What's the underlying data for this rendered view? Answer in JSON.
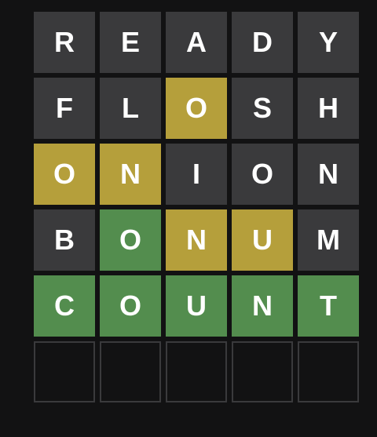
{
  "colors": {
    "background": "#121213",
    "absent": "#3a3a3c",
    "present": "#b59f3b",
    "correct": "#538d4e",
    "empty_border": "#3a3a3c",
    "letter": "#ffffff"
  },
  "board": {
    "rows": [
      {
        "letters": [
          "R",
          "E",
          "A",
          "D",
          "Y"
        ],
        "states": [
          "absent",
          "absent",
          "absent",
          "absent",
          "absent"
        ]
      },
      {
        "letters": [
          "F",
          "L",
          "O",
          "S",
          "H"
        ],
        "states": [
          "absent",
          "absent",
          "present",
          "absent",
          "absent"
        ]
      },
      {
        "letters": [
          "O",
          "N",
          "I",
          "O",
          "N"
        ],
        "states": [
          "present",
          "present",
          "absent",
          "absent",
          "absent"
        ]
      },
      {
        "letters": [
          "B",
          "O",
          "N",
          "U",
          "M"
        ],
        "states": [
          "absent",
          "correct",
          "present",
          "present",
          "absent"
        ]
      },
      {
        "letters": [
          "C",
          "O",
          "U",
          "N",
          "T"
        ],
        "states": [
          "correct",
          "correct",
          "correct",
          "correct",
          "correct"
        ]
      },
      {
        "letters": [
          "",
          "",
          "",
          "",
          ""
        ],
        "states": [
          "empty",
          "empty",
          "empty",
          "empty",
          "empty"
        ]
      }
    ]
  }
}
